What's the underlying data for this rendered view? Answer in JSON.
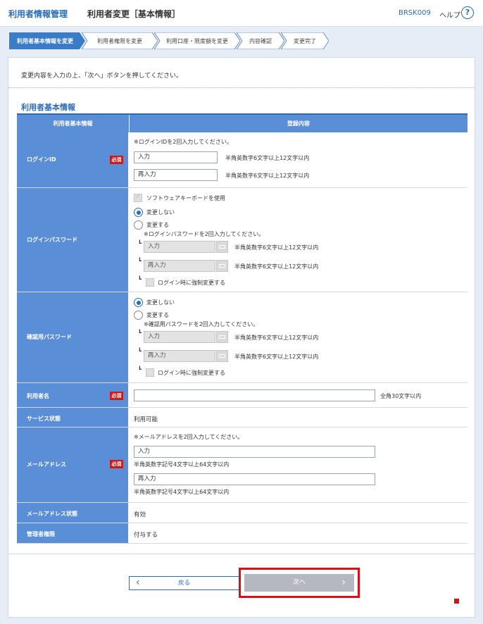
{
  "header": {
    "app_title": "利用者情報管理",
    "page_title": "利用者変更［基本情報］",
    "screen_code": "BRSK009",
    "help_label": "ヘルプ",
    "help_icon": "?"
  },
  "steps": [
    {
      "label": "利用者基本情報を変更",
      "active": true
    },
    {
      "label": "利用者権限を変更",
      "active": false
    },
    {
      "label": "利用口座・限度額を変更",
      "active": false
    },
    {
      "label": "内容確認",
      "active": false
    },
    {
      "label": "変更完了",
      "active": false
    }
  ],
  "intro_text": "変更内容を入力の上、「次へ」ボタンを押してください。",
  "section_title": "利用者基本情報",
  "table": {
    "col1": "利用者基本情報",
    "col2": "登録内容",
    "required_badge": "必須",
    "login_id": {
      "label": "ログインID",
      "note": "※ログインIDを2回入力してください。",
      "input1": "入力",
      "input2": "再入力",
      "hint": "半角英数字6文字以上12文字以内"
    },
    "login_password": {
      "label": "ログインパスワード",
      "software_kb": "ソフトウェアキーボードを使用",
      "no_change": "変更しない",
      "change": "変更する",
      "note": "※ログインパスワードを2回入力してください。",
      "input1": "入力",
      "input2": "再入力",
      "hint": "半角英数字6文字以上12文字以内",
      "force_change": "ログイン時に強制変更する"
    },
    "confirm_password": {
      "label": "確認用パスワード",
      "no_change": "変更しない",
      "change": "変更する",
      "note": "※確認用パスワードを2回入力してください。",
      "input1": "入力",
      "input2": "再入力",
      "hint": "半角英数字6文字以上12文字以内",
      "force_change": "ログイン時に強制変更する"
    },
    "user_name": {
      "label": "利用者名",
      "value": "",
      "hint": "全角30文字以内"
    },
    "service_status": {
      "label": "サービス状態",
      "value": "利用可能"
    },
    "email": {
      "label": "メールアドレス",
      "note": "※メールアドレスを2回入力してください。",
      "input1": "入力",
      "input2": "再入力",
      "hint": "半角英数字記号4文字以上64文字以内"
    },
    "email_status": {
      "label": "メールアドレス状態",
      "value": "有効"
    },
    "admin_authority": {
      "label": "管理者権限",
      "value": "付与する"
    }
  },
  "buttons": {
    "back": "戻る",
    "next": "次へ"
  },
  "colors": {
    "accent": "#2a6bb8",
    "label_bg": "#5a8fd8",
    "required": "#c71c1c",
    "highlight": "#d3131a"
  }
}
